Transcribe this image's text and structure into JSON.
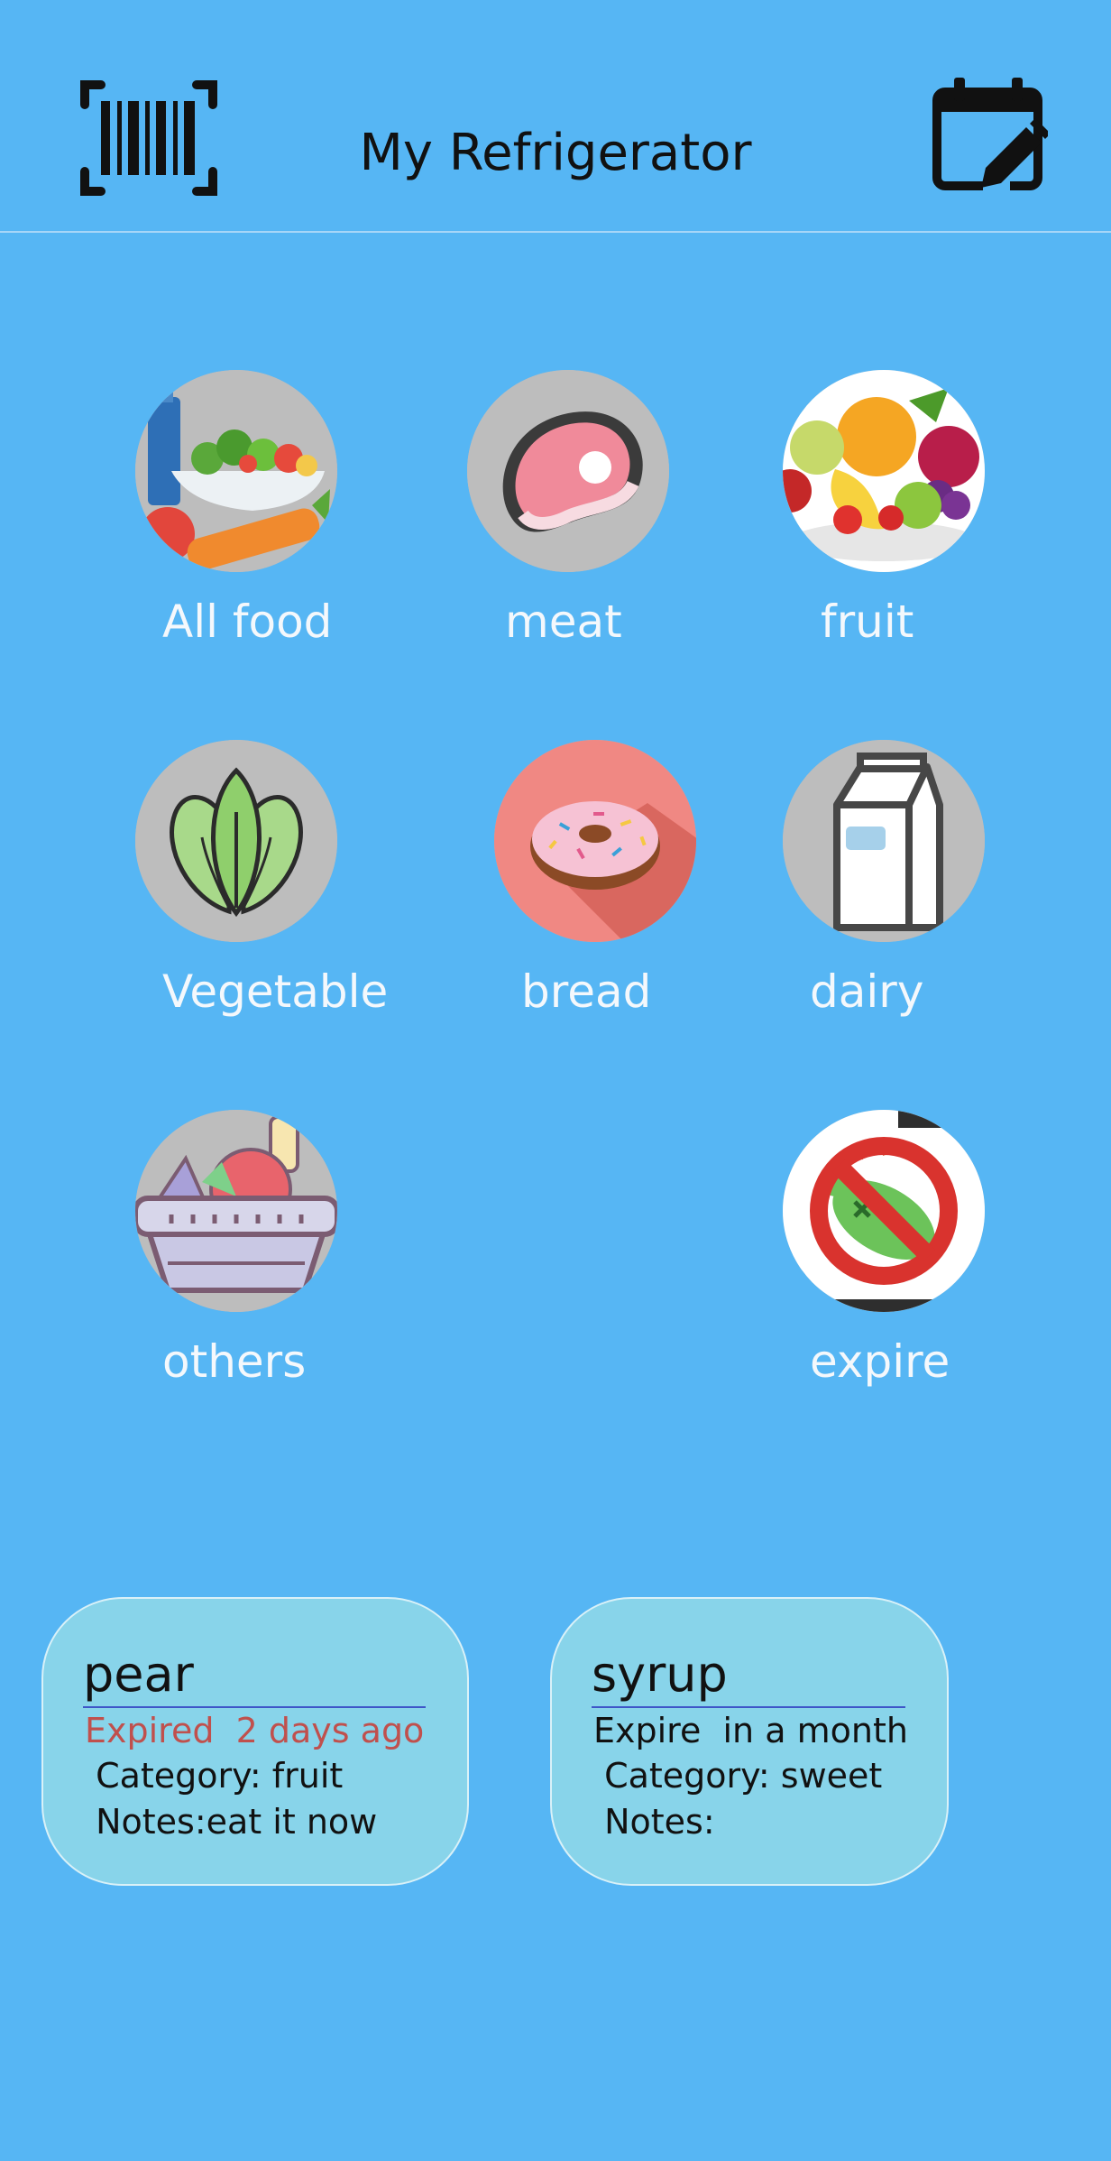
{
  "header": {
    "title": "My Refrigerator",
    "left_icon": "barcode-scan-icon",
    "right_icon": "calendar-edit-icon"
  },
  "categories": [
    {
      "label": "All food",
      "icon": "all-food-icon"
    },
    {
      "label": "meat",
      "icon": "meat-icon"
    },
    {
      "label": "fruit",
      "icon": "fruit-icon"
    },
    {
      "label": "Vegetable",
      "icon": "vegetable-icon"
    },
    {
      "label": "bread",
      "icon": "donut-icon"
    },
    {
      "label": "dairy",
      "icon": "milk-carton-icon"
    },
    {
      "label": "others",
      "icon": "basket-icon"
    },
    {
      "label": "expire",
      "icon": "expired-food-icon"
    }
  ],
  "items": [
    {
      "name": "pear",
      "status": "Expired  2 days ago",
      "category": " Category: fruit",
      "notes": " Notes:eat it now",
      "status_color": "#c0504d"
    },
    {
      "name": "syrup",
      "status": "Expire  in a month",
      "category": " Category: sweet",
      "notes": " Notes:"
    }
  ],
  "colors": {
    "background": "#56b6f4",
    "card": "#88d4ea",
    "expired_text": "#c0504d"
  }
}
